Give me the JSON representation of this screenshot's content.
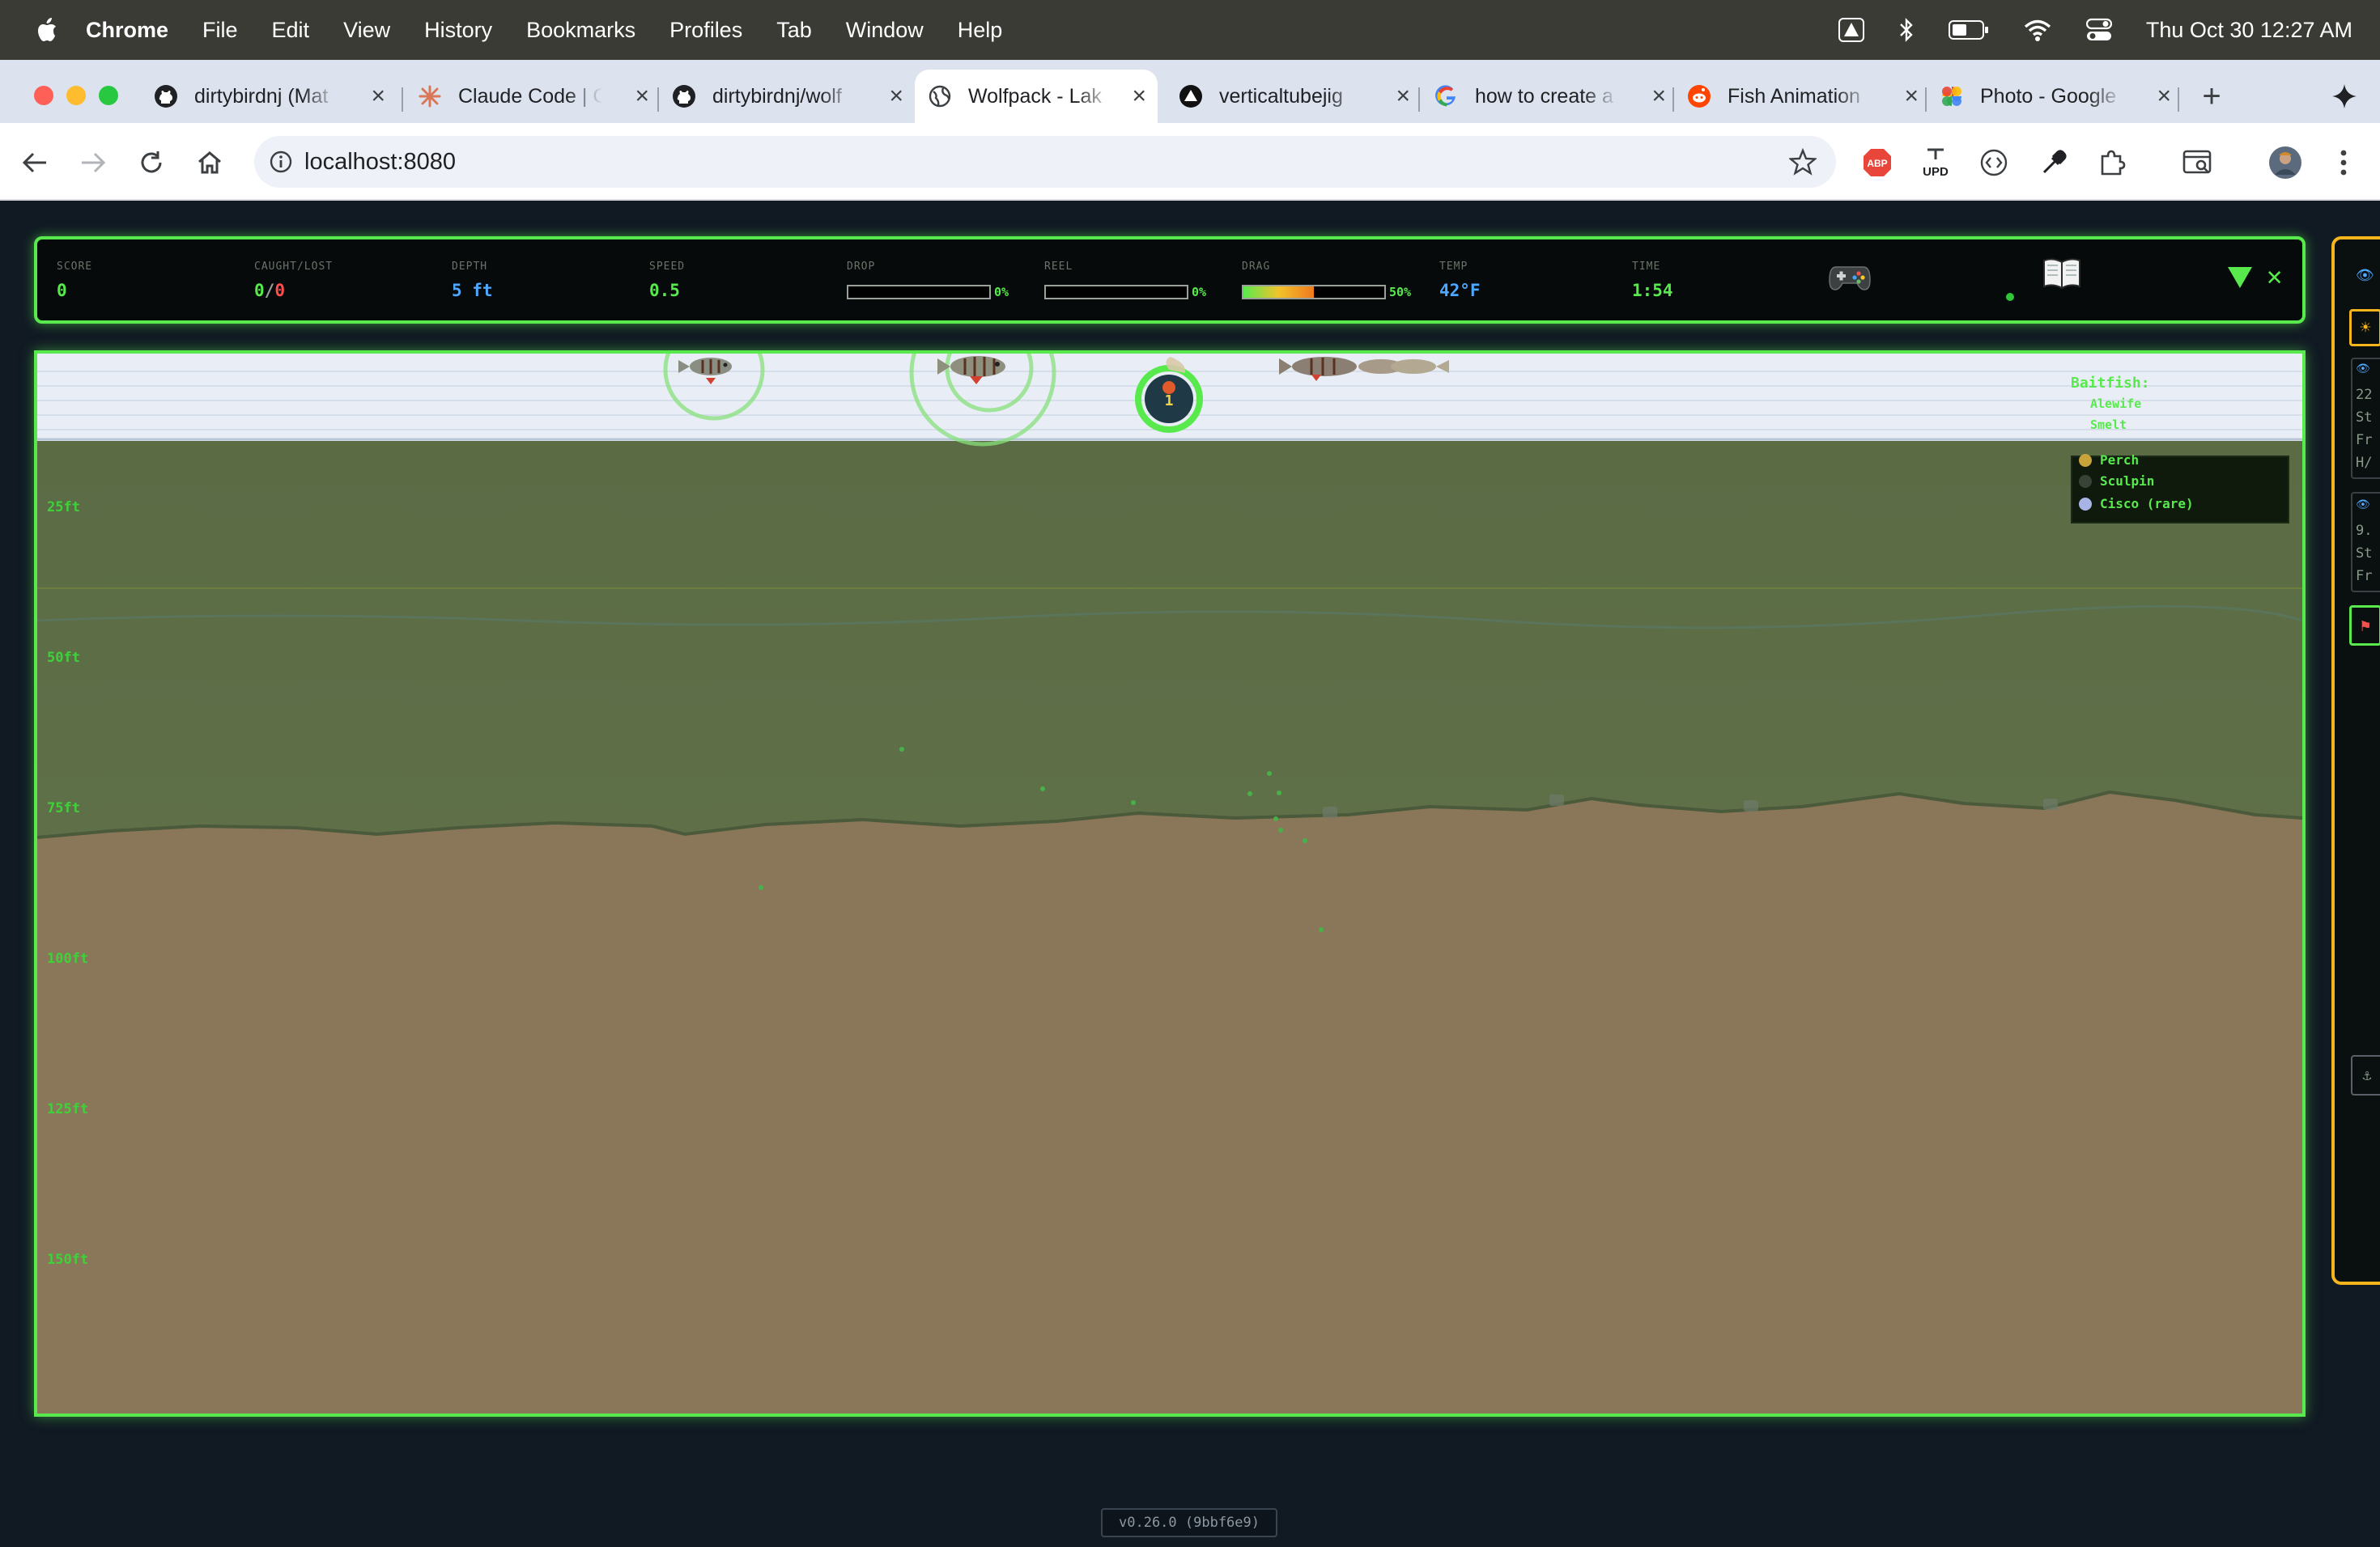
{
  "menubar": {
    "app": "Chrome",
    "items": [
      "File",
      "Edit",
      "View",
      "History",
      "Bookmarks",
      "Profiles",
      "Tab",
      "Window",
      "Help"
    ],
    "clock": "Thu Oct 30  12:27 AM"
  },
  "tabs": [
    {
      "title": "dirtybirdnj (Mat",
      "icon": "github-icon"
    },
    {
      "title": "Claude Code | C",
      "icon": "claude-icon"
    },
    {
      "title": "dirtybirdnj/wolf",
      "icon": "github-icon"
    },
    {
      "title": "Wolfpack - Lak",
      "icon": "globe-icon",
      "active": true
    },
    {
      "title": "verticaltubejig",
      "icon": "vercel-icon"
    },
    {
      "title": "how to create a",
      "icon": "google-icon"
    },
    {
      "title": "Fish Animation",
      "icon": "reddit-icon"
    },
    {
      "title": "Photo - Google",
      "icon": "google-photos-icon"
    }
  ],
  "toolbar": {
    "url": "localhost:8080"
  },
  "hud": {
    "score": {
      "label": "SCORE",
      "value": "0"
    },
    "caught": {
      "label": "CAUGHT/LOST",
      "value_a": "0",
      "sep": "/",
      "value_b": "0"
    },
    "depth": {
      "label": "DEPTH",
      "value": "5 ft"
    },
    "speed": {
      "label": "SPEED",
      "value": "0.5"
    },
    "drop": {
      "label": "DROP",
      "pct": "0%",
      "level": 0
    },
    "reel": {
      "label": "REEL",
      "pct": "0%",
      "level": 0
    },
    "drag": {
      "label": "DRAG",
      "pct": "50%",
      "level": 0.5
    },
    "temp": {
      "label": "TEMP",
      "value": "42°F"
    },
    "time": {
      "label": "TIME",
      "value": "1:54"
    }
  },
  "sonar": {
    "depth_marks": [
      "25ft",
      "50ft",
      "75ft",
      "100ft",
      "125ft",
      "150ft"
    ],
    "lure_number": "1",
    "legend": {
      "title": "Baitfish:",
      "baitfish": [
        "Alewife",
        "Smelt"
      ],
      "species": [
        {
          "name": "Perch",
          "color": "#c8a23a"
        },
        {
          "name": "Sculpin",
          "color": "#3a4238"
        },
        {
          "name": "Cisco (rare)",
          "color": "#a9b4e6"
        }
      ]
    }
  },
  "side_panel": {
    "lines": [
      "22",
      "St",
      "Fr",
      "H/",
      "9.",
      "St",
      "Fr"
    ]
  },
  "version": "v0.26.0 (9bbf6e9)",
  "colors": {
    "accent": "#58ea4d",
    "water": "#5b6e46",
    "bottom": "#8a7658",
    "surface": "#e9eef6",
    "panel_border": "#f6b51b"
  }
}
